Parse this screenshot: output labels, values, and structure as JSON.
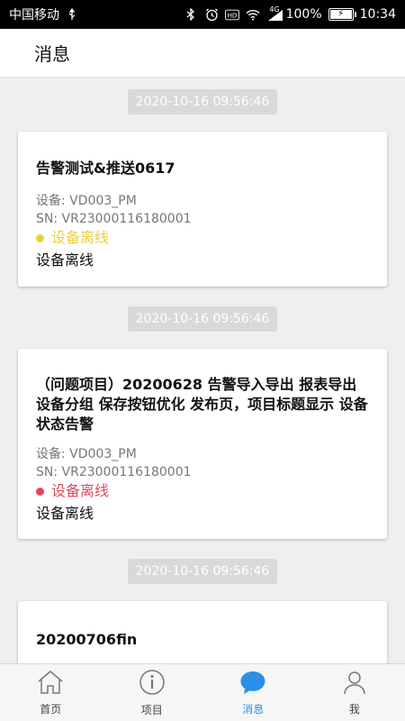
{
  "status_bar": {
    "carrier": "中国移动",
    "battery": "100%",
    "time": "10:34",
    "network": "4G"
  },
  "header": {
    "title": "消息"
  },
  "messages": [
    {
      "timestamp": "2020-10-16 09:56:46",
      "title": "告警测试&推送0617",
      "device": "设备: VD003_PM",
      "sn": "SN: VR23000116180001",
      "status": "设备离线",
      "status_color": "#e8d13a",
      "description": "设备离线"
    },
    {
      "timestamp": "2020-10-16 09:56:46",
      "title": "（问题项目）20200628 告警导入导出 报表导出 设备分组 保存按钮优化 发布页，项目标题显示 设备状态告警",
      "device": "设备: VD003_PM",
      "sn": "SN: VR23000116180001",
      "status": "设备离线",
      "status_color": "#e0485a",
      "description": "设备离线"
    },
    {
      "timestamp": "2020-10-16 09:56:46",
      "title": "20200706fin"
    }
  ],
  "tabs": [
    {
      "label": "首页",
      "icon": "home-icon"
    },
    {
      "label": "项目",
      "icon": "info-icon"
    },
    {
      "label": "消息",
      "icon": "chat-icon",
      "active": true
    },
    {
      "label": "我",
      "icon": "person-icon"
    }
  ],
  "colors": {
    "accent": "#2b8fe6"
  }
}
